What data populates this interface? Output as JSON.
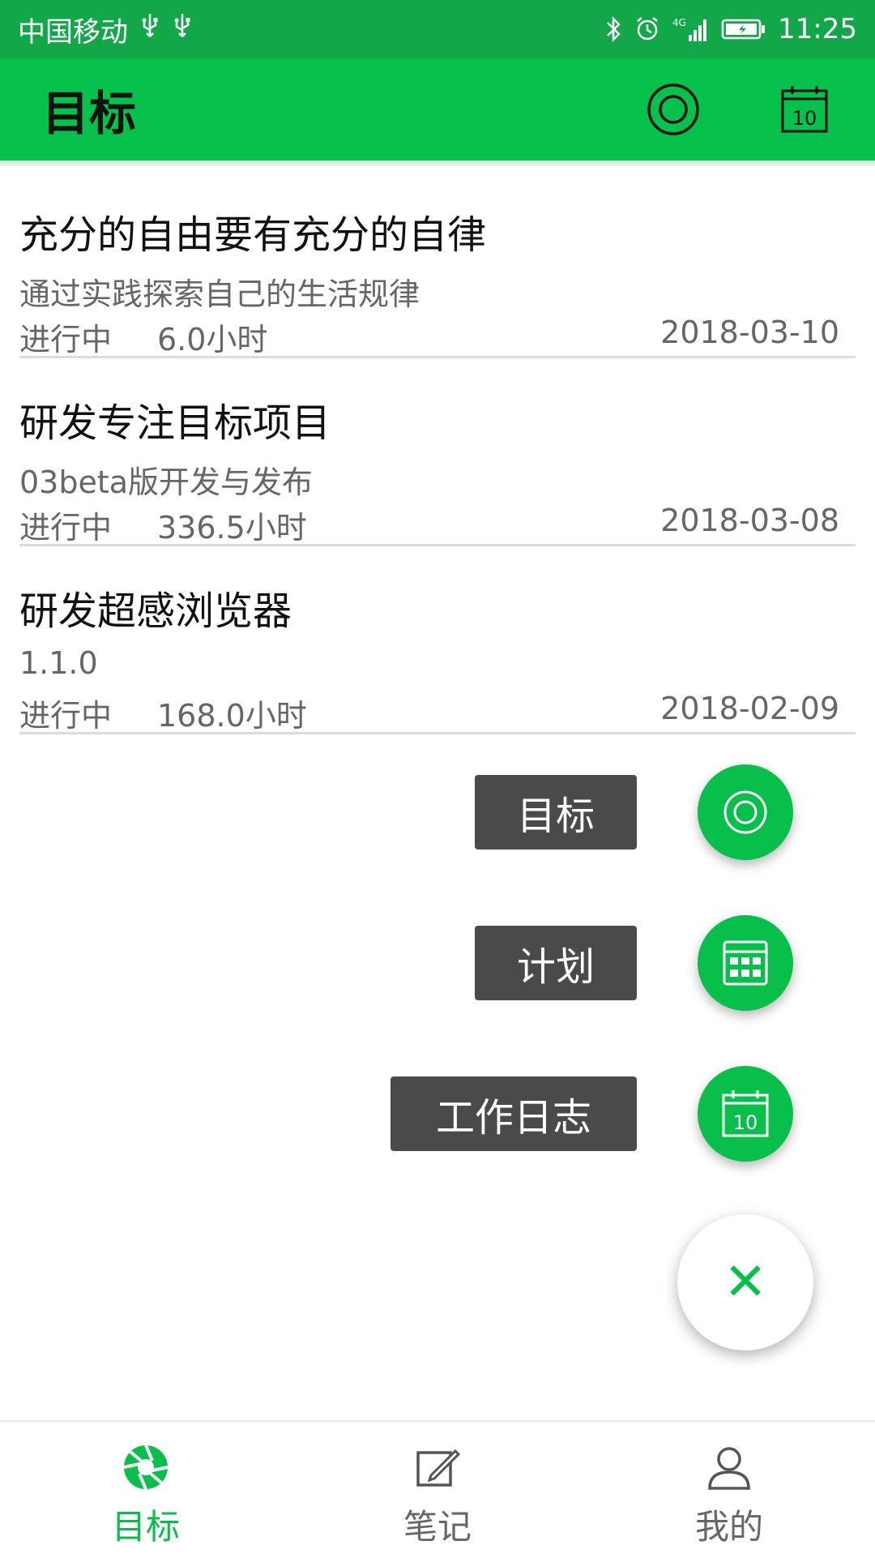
{
  "status_bar": {
    "carrier": "中国移动",
    "time": "11:25",
    "network": "4G"
  },
  "app_bar": {
    "title": "目标"
  },
  "goals": [
    {
      "title": "充分的自由要有充分的自律",
      "subtitle": "通过实践探索自己的生活规律",
      "status": "进行中",
      "hours": "6.0小时",
      "date": "2018-03-10"
    },
    {
      "title": "研发专注目标项目",
      "subtitle": "03beta版开发与发布",
      "status": "进行中",
      "hours": "336.5小时",
      "date": "2018-03-08"
    },
    {
      "title": "研发超感浏览器",
      "subtitle": "1.1.0",
      "status": "进行中",
      "hours": "168.0小时",
      "date": "2018-02-09"
    }
  ],
  "fab_menu": {
    "items": [
      {
        "label": "目标",
        "icon": "target-icon"
      },
      {
        "label": "计划",
        "icon": "grid-calendar-icon"
      },
      {
        "label": "工作日志",
        "icon": "calendar-10-icon"
      }
    ],
    "close_icon": "close-icon",
    "close_symbol": "✕"
  },
  "bottom_nav": {
    "items": [
      {
        "label": "目标",
        "icon": "aperture-icon"
      },
      {
        "label": "笔记",
        "icon": "note-edit-icon"
      },
      {
        "label": "我的",
        "icon": "user-icon"
      }
    ]
  },
  "colors": {
    "primary": "#06c14c",
    "status_bar": "#12a84a",
    "fab_label_bg": "#4a4a4a"
  }
}
